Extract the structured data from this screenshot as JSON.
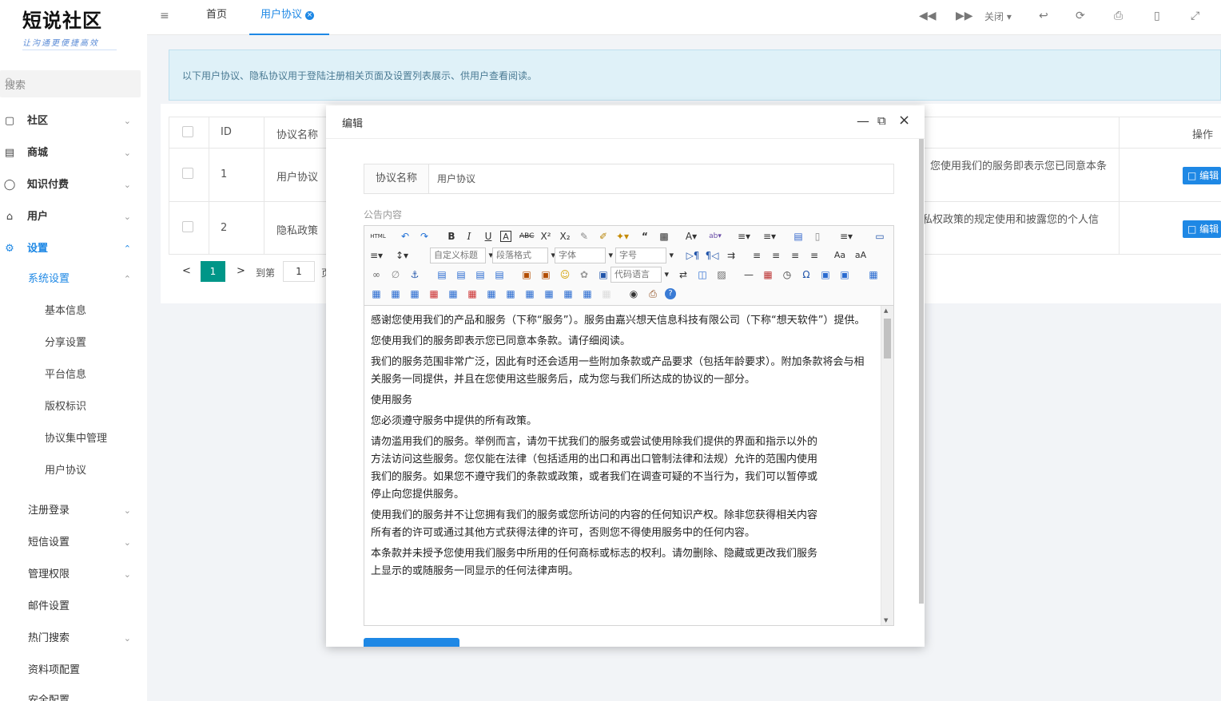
{
  "brand": {
    "title": "短说社区",
    "slogan": "让沟通更便捷高效"
  },
  "search": {
    "placeholder": "搜索"
  },
  "nav": [
    {
      "label": "社区",
      "icon": "comment-icon"
    },
    {
      "label": "商城",
      "icon": "store-icon"
    },
    {
      "label": "知识付费",
      "icon": "bulb-icon"
    },
    {
      "label": "用户",
      "icon": "user-icon"
    },
    {
      "label": "设置",
      "icon": "gear-icon"
    }
  ],
  "settings": {
    "group": "系统设置",
    "items": [
      "基本信息",
      "分享设置",
      "平台信息",
      "版权标识",
      "协议集中管理",
      "用户协议"
    ],
    "others": [
      "注册登录",
      "短信设置",
      "管理权限",
      "邮件设置",
      "热门搜索",
      "资料项配置",
      "安全配置"
    ]
  },
  "header": {
    "tabs": [
      "首页",
      "用户协议"
    ],
    "close_label": "关闭"
  },
  "tip": "以下用户协议、隐私协议用于登陆注册相关页面及设置列表展示、供用户查看阅读。",
  "table": {
    "headers": {
      "id": "ID",
      "name": "协议名称",
      "action": "操作"
    },
    "rows": [
      {
        "id": "1",
        "name": "用户协议",
        "content": "您使用我们的服务即表示您已同意本条",
        "action": "编辑"
      },
      {
        "id": "2",
        "name": "隐私政策",
        "content": "私权政策的规定使用和披露您的个人信",
        "action": "编辑"
      }
    ]
  },
  "pager": {
    "current": "1",
    "goto_label": "到第",
    "page_input": "1",
    "page_suffix": "页"
  },
  "dialog": {
    "title": "编辑",
    "name_label": "协议名称",
    "name_value": "用户协议",
    "content_label": "公告内容",
    "toolbar": {
      "html": "HTML",
      "custom_title": "自定义标题",
      "paragraph": "段落格式",
      "font": "字体",
      "size": "字号",
      "code_lang": "代码语言"
    },
    "paragraphs": [
      "感谢您使用我们的产品和服务（下称“服务”）。服务由嘉兴想天信息科技有限公司（下称“想天软件”）提供。",
      "您使用我们的服务即表示您已同意本条款。请仔细阅读。",
      "我们的服务范围非常广泛，因此有时还会适用一些附加条款或产品要求（包括年龄要求）。附加条款将会与相关服务一同提供，并且在您使用这些服务后，成为您与我们所达成的协议的一部分。",
      "使用服务",
      "您必须遵守服务中提供的所有政策。",
      "请勿滥用我们的服务。举例而言，请勿干扰我们的服务或尝试使用除我们提供的界面和指示以外的方法访问这些服务。您仅能在法律（包括适用的出口和再出口管制法律和法规）允许的范围内使用我们的服务。如果您不遵守我们的条款或政策，或者我们在调查可疑的不当行为，我们可以暂停或停止向您提供服务。",
      "使用我们的服务并不让您拥有我们的服务或您所访问的内容的任何知识产权。除非您获得相关内容所有者的许可或通过其他方式获得法律的许可，否则您不得使用服务中的任何内容。",
      "本条款并未授予您使用我们服务中所用的任何商标或标志的权利。请勿删除、隐藏或更改我们服务上显示的或随服务一同显示的任何法律声明。"
    ]
  }
}
